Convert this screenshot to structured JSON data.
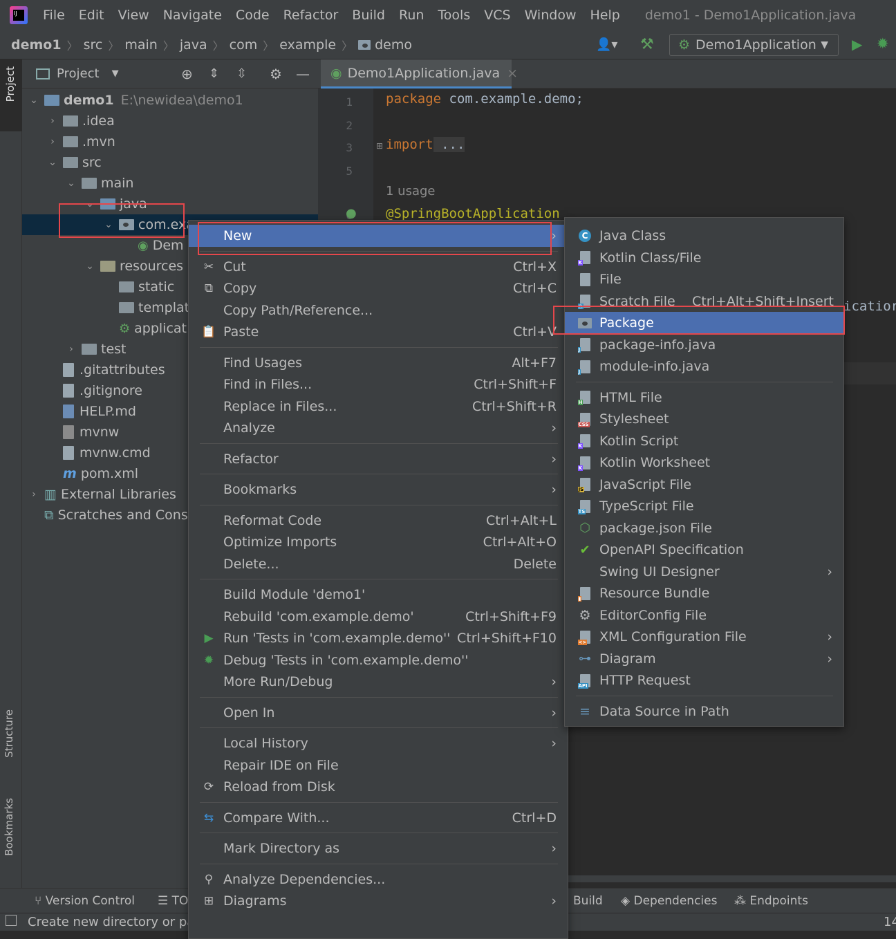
{
  "menubar": {
    "items": [
      "File",
      "Edit",
      "View",
      "Navigate",
      "Code",
      "Refactor",
      "Build",
      "Run",
      "Tools",
      "VCS",
      "Window",
      "Help"
    ],
    "window_title": "demo1 - Demo1Application.java"
  },
  "breadcrumb": [
    "demo1",
    "src",
    "main",
    "java",
    "com",
    "example",
    "demo"
  ],
  "toolbar": {
    "run_config": "Demo1Application"
  },
  "side_tabs": {
    "project": "Project",
    "structure": "Structure",
    "bookmarks": "Bookmarks"
  },
  "project_panel": {
    "title": "Project",
    "tree": [
      {
        "label": "demo1",
        "path": "E:\\newidea\\demo1",
        "depth": 0,
        "arrow": "down",
        "icon": "module-folder"
      },
      {
        "label": ".idea",
        "depth": 1,
        "arrow": "right",
        "icon": "folder"
      },
      {
        "label": ".mvn",
        "depth": 1,
        "arrow": "right",
        "icon": "folder"
      },
      {
        "label": "src",
        "depth": 1,
        "arrow": "down",
        "icon": "folder"
      },
      {
        "label": "main",
        "depth": 2,
        "arrow": "down",
        "icon": "folder"
      },
      {
        "label": "java",
        "depth": 3,
        "arrow": "down",
        "icon": "source-folder"
      },
      {
        "label": "com.exa",
        "depth": 4,
        "arrow": "down",
        "icon": "package",
        "selected": true
      },
      {
        "label": "Dem",
        "depth": 5,
        "arrow": "",
        "icon": "spring-class"
      },
      {
        "label": "resources",
        "depth": 3,
        "arrow": "down",
        "icon": "resource-folder"
      },
      {
        "label": "static",
        "depth": 4,
        "arrow": "",
        "icon": "folder"
      },
      {
        "label": "templat",
        "depth": 4,
        "arrow": "",
        "icon": "folder"
      },
      {
        "label": "applicat",
        "depth": 4,
        "arrow": "",
        "icon": "spring-config"
      },
      {
        "label": "test",
        "depth": 2,
        "arrow": "right",
        "icon": "folder"
      },
      {
        "label": ".gitattributes",
        "depth": 1,
        "arrow": "",
        "icon": "file"
      },
      {
        "label": ".gitignore",
        "depth": 1,
        "arrow": "",
        "icon": "file"
      },
      {
        "label": "HELP.md",
        "depth": 1,
        "arrow": "",
        "icon": "markdown"
      },
      {
        "label": "mvnw",
        "depth": 1,
        "arrow": "",
        "icon": "script"
      },
      {
        "label": "mvnw.cmd",
        "depth": 1,
        "arrow": "",
        "icon": "file"
      },
      {
        "label": "pom.xml",
        "depth": 1,
        "arrow": "",
        "icon": "maven"
      },
      {
        "label": "External Libraries",
        "depth": 0,
        "arrow": "right",
        "icon": "libraries"
      },
      {
        "label": "Scratches and Conso",
        "depth": 0,
        "arrow": "",
        "icon": "scratches"
      }
    ]
  },
  "editor": {
    "tab": "Demo1Application.java",
    "lines": [
      {
        "num": "1",
        "kw": "package",
        "rest": " com.example.demo;"
      },
      {
        "num": "2",
        "kw": "",
        "rest": ""
      },
      {
        "num": "3",
        "kw": "import",
        "rest": " ..."
      },
      {
        "num": "5",
        "kw": "",
        "rest": ""
      }
    ],
    "usage_hint": "1 usage",
    "annotation": "@SpringBootApplication",
    "annotation_line": "6",
    "right_fragment": "icatior"
  },
  "context_menu": {
    "items": [
      {
        "label": "New",
        "shortcut": "",
        "submenu": true,
        "highlight": true
      },
      {
        "sep": true
      },
      {
        "label": "Cut",
        "shortcut": "Ctrl+X",
        "icon": "cut-icon",
        "glyph": "✂"
      },
      {
        "label": "Copy",
        "shortcut": "Ctrl+C",
        "icon": "copy-icon",
        "glyph": "⧉"
      },
      {
        "label": "Copy Path/Reference...",
        "shortcut": ""
      },
      {
        "label": "Paste",
        "shortcut": "Ctrl+V",
        "icon": "paste-icon",
        "glyph": "📋"
      },
      {
        "sep": true
      },
      {
        "label": "Find Usages",
        "shortcut": "Alt+F7"
      },
      {
        "label": "Find in Files...",
        "shortcut": "Ctrl+Shift+F"
      },
      {
        "label": "Replace in Files...",
        "shortcut": "Ctrl+Shift+R"
      },
      {
        "label": "Analyze",
        "submenu": true
      },
      {
        "sep": true
      },
      {
        "label": "Refactor",
        "submenu": true
      },
      {
        "sep": true
      },
      {
        "label": "Bookmarks",
        "submenu": true
      },
      {
        "sep": true
      },
      {
        "label": "Reformat Code",
        "shortcut": "Ctrl+Alt+L"
      },
      {
        "label": "Optimize Imports",
        "shortcut": "Ctrl+Alt+O"
      },
      {
        "label": "Delete...",
        "shortcut": "Delete"
      },
      {
        "sep": true
      },
      {
        "label": "Build Module 'demo1'",
        "shortcut": ""
      },
      {
        "label": "Rebuild 'com.example.demo'",
        "shortcut": "Ctrl+Shift+F9"
      },
      {
        "label": "Run 'Tests in 'com.example.demo''",
        "shortcut": "Ctrl+Shift+F10",
        "icon": "run-icon",
        "glyph": "▶"
      },
      {
        "label": "Debug 'Tests in 'com.example.demo''",
        "shortcut": "",
        "icon": "debug-icon",
        "glyph": "✹"
      },
      {
        "label": "More Run/Debug",
        "submenu": true
      },
      {
        "sep": true
      },
      {
        "label": "Open In",
        "submenu": true
      },
      {
        "sep": true
      },
      {
        "label": "Local History",
        "submenu": true
      },
      {
        "label": "Repair IDE on File",
        "shortcut": ""
      },
      {
        "label": "Reload from Disk",
        "shortcut": "",
        "icon": "reload-icon",
        "glyph": "⟳"
      },
      {
        "sep": true
      },
      {
        "label": "Compare With...",
        "shortcut": "Ctrl+D",
        "icon": "compare-icon",
        "glyph": "⇆"
      },
      {
        "sep": true
      },
      {
        "label": "Mark Directory as",
        "submenu": true
      },
      {
        "sep": true
      },
      {
        "label": "Analyze Dependencies...",
        "shortcut": "",
        "icon": "analyze-deps-icon",
        "glyph": "⚲"
      },
      {
        "label": "Diagrams",
        "submenu": true,
        "icon": "diagrams-icon",
        "glyph": "⊞"
      }
    ]
  },
  "new_submenu": {
    "items": [
      {
        "label": "Java Class",
        "icon": "java-class-icon"
      },
      {
        "label": "Kotlin Class/File",
        "icon": "kotlin-file-icon"
      },
      {
        "label": "File",
        "icon": "file-icon"
      },
      {
        "label": "Scratch File",
        "shortcut": "Ctrl+Alt+Shift+Insert",
        "icon": "scratch-file-icon"
      },
      {
        "label": "Package",
        "icon": "package-icon",
        "highlight": true
      },
      {
        "label": "package-info.java",
        "icon": "java-file-icon"
      },
      {
        "label": "module-info.java",
        "icon": "java-file-icon"
      },
      {
        "sep": true
      },
      {
        "label": "HTML File",
        "icon": "html-file-icon"
      },
      {
        "label": "Stylesheet",
        "icon": "css-file-icon"
      },
      {
        "label": "Kotlin Script",
        "icon": "kotlin-script-icon"
      },
      {
        "label": "Kotlin Worksheet",
        "icon": "kotlin-worksheet-icon"
      },
      {
        "label": "JavaScript File",
        "icon": "js-file-icon"
      },
      {
        "label": "TypeScript File",
        "icon": "ts-file-icon"
      },
      {
        "label": "package.json File",
        "icon": "nodejs-icon"
      },
      {
        "label": "OpenAPI Specification",
        "icon": "openapi-icon"
      },
      {
        "label": "Swing UI Designer",
        "submenu": true,
        "icon": ""
      },
      {
        "label": "Resource Bundle",
        "icon": "resource-bundle-icon"
      },
      {
        "label": "EditorConfig File",
        "icon": "gear-icon"
      },
      {
        "label": "XML Configuration File",
        "submenu": true,
        "icon": "xml-file-icon"
      },
      {
        "label": "Diagram",
        "submenu": true,
        "icon": "diagram-icon"
      },
      {
        "label": "HTTP Request",
        "icon": "api-file-icon"
      },
      {
        "sep": true
      },
      {
        "label": "Data Source in Path",
        "icon": "database-icon"
      }
    ]
  },
  "bottom_tools": {
    "version_control": "Version Control",
    "todo": "TO",
    "build": "Build",
    "dependencies": "Dependencies",
    "endpoints": "Endpoints"
  },
  "status": {
    "message": "Create new directory or pac",
    "right": "14"
  }
}
